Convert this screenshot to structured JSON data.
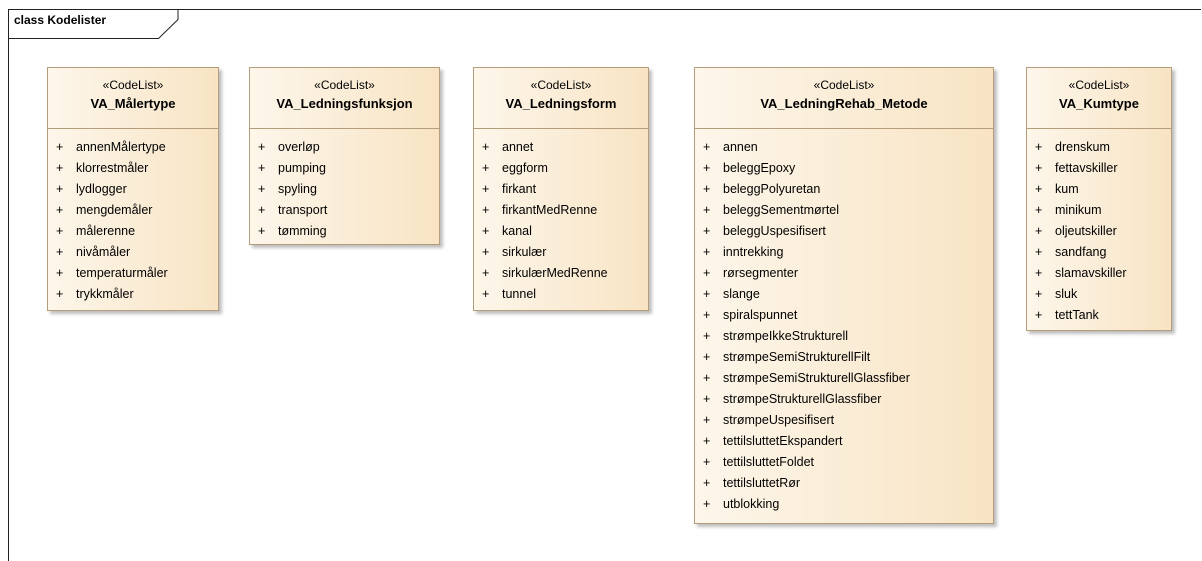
{
  "frame": {
    "title": "class Kodelister"
  },
  "classes": [
    {
      "stereotype": "«CodeList»",
      "name": "VA_Målertype",
      "attributes": [
        "annenMålertype",
        "klorrestmåler",
        "lydlogger",
        "mengdemåler",
        "målerenne",
        "nivåmåler",
        "temperaturmåler",
        "trykkmåler"
      ]
    },
    {
      "stereotype": "«CodeList»",
      "name": "VA_Ledningsfunksjon",
      "attributes": [
        "overløp",
        "pumping",
        "spyling",
        "transport",
        "tømming"
      ]
    },
    {
      "stereotype": "«CodeList»",
      "name": "VA_Ledningsform",
      "attributes": [
        "annet",
        "eggform",
        "firkant",
        "firkantMedRenne",
        "kanal",
        "sirkulær",
        "sirkulærMedRenne",
        "tunnel"
      ]
    },
    {
      "stereotype": "«CodeList»",
      "name": "VA_LedningRehab_Metode",
      "attributes": [
        "annen",
        "beleggEpoxy",
        "beleggPolyuretan",
        "beleggSementmørtel",
        "beleggUspesifisert",
        "inntrekking",
        "rørsegmenter",
        "slange",
        "spiralspunnet",
        "strømpeIkkeStrukturell",
        "strømpeSemiStrukturellFilt",
        "strømpeSemiStrukturellGlassfiber",
        "strømpeStrukturellGlassfiber",
        "strømpeUspesifisert",
        "tettilsluttetEkspandert",
        "tettilsluttetFoldet",
        "tettilsluttetRør",
        "utblokking"
      ]
    },
    {
      "stereotype": "«CodeList»",
      "name": "VA_Kumtype",
      "attributes": [
        "drenskum",
        "fettavskiller",
        "kum",
        "minikum",
        "oljeutskiller",
        "sandfang",
        "slamavskiller",
        "sluk",
        "tettTank"
      ]
    }
  ],
  "visibility_symbol": "+"
}
